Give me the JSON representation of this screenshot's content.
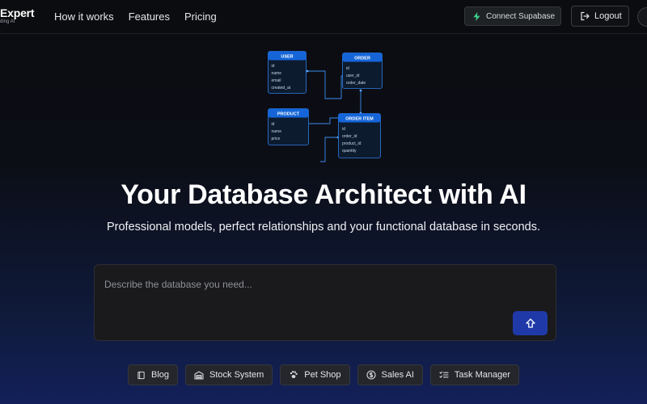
{
  "brand": {
    "title": "Expert",
    "subtitle": "ding AI"
  },
  "nav": {
    "links": [
      "How it works",
      "Features",
      "Pricing"
    ]
  },
  "actions": {
    "supabase_label": "Connect Supabase",
    "logout_label": "Logout",
    "supabase_icon": "bolt-icon",
    "logout_icon": "logout-icon"
  },
  "diagram": {
    "tables": [
      {
        "name": "USER",
        "fields": [
          "id",
          "name",
          "email",
          "created_at"
        ]
      },
      {
        "name": "ORDER",
        "fields": [
          "id",
          "user_id",
          "order_date"
        ]
      },
      {
        "name": "PRODUCT",
        "fields": [
          "id",
          "name",
          "price"
        ]
      },
      {
        "name": "ORDER ITEM",
        "fields": [
          "id",
          "order_id",
          "product_id",
          "quantity"
        ]
      }
    ]
  },
  "hero": {
    "title": "Your Database Architect with AI",
    "subtitle": "Professional models, perfect relationships and your functional database in seconds."
  },
  "prompt": {
    "placeholder": "Describe the database you need...",
    "value": "",
    "send_icon": "arrow-up-icon"
  },
  "examples": [
    {
      "label": "Blog",
      "icon": "book-icon"
    },
    {
      "label": "Stock System",
      "icon": "warehouse-icon"
    },
    {
      "label": "Pet Shop",
      "icon": "paw-icon"
    },
    {
      "label": "Sales AI",
      "icon": "dollar-icon"
    },
    {
      "label": "Task Manager",
      "icon": "checklist-icon"
    }
  ],
  "colors": {
    "accent": "#1f3aa8",
    "diagram_header": "#1565d8",
    "supabase_green": "#3ecf8e",
    "background_bottom": "#13205a"
  }
}
